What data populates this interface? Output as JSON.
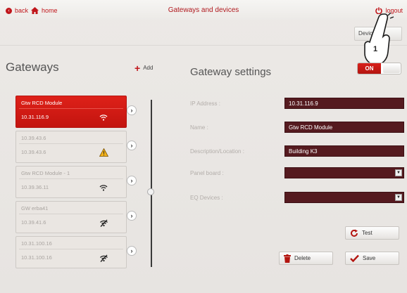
{
  "header": {
    "back_label": "back",
    "home_label": "home",
    "title": "Gateways and devices",
    "logout_label": "logout",
    "devices_tab_label": "Devices"
  },
  "sidebar": {
    "heading": "Gateways",
    "add_label": "Add",
    "gateways": [
      {
        "name": "Gtw RCD Module",
        "ip": "10.31.116.9",
        "status": "wifi-strong",
        "active": true
      },
      {
        "name": "10.39.43.6",
        "ip": "10.39.43.6",
        "status": "warning",
        "active": false
      },
      {
        "name": "Gtw RCD Module - 1",
        "ip": "10.39.36.11",
        "status": "wifi-strong",
        "active": false
      },
      {
        "name": "GW erba41",
        "ip": "10.39.41.6",
        "status": "wifi-off",
        "active": false
      },
      {
        "name": "10.31.100.16",
        "ip": "10.31.100.16",
        "status": "wifi-off",
        "active": false
      }
    ]
  },
  "settings": {
    "heading": "Gateway settings",
    "toggle_label": "ON",
    "fields": {
      "ip_label": "IP Address :",
      "ip_value": "10.31.116.9",
      "name_label": "Name :",
      "name_value": "Gtw RCD Module",
      "desc_label": "Description/Location :",
      "desc_value": "Building K3",
      "panel_label": "Panel board :",
      "panel_value": "",
      "eq_label": "EQ Devices :",
      "eq_value": ""
    },
    "test_label": "Test",
    "delete_label": "Delete",
    "save_label": "Save"
  },
  "annotation": {
    "callout_number": "1"
  },
  "colors": {
    "accent": "#c0161b",
    "field_bg": "#551a1f",
    "active_card": "#d41b15"
  },
  "icons": {
    "back": "back-circle-icon",
    "home": "home-icon",
    "logout": "power-icon",
    "add": "plus-icon",
    "test": "refresh-icon",
    "delete": "trash-icon",
    "save": "checkmark-icon"
  }
}
